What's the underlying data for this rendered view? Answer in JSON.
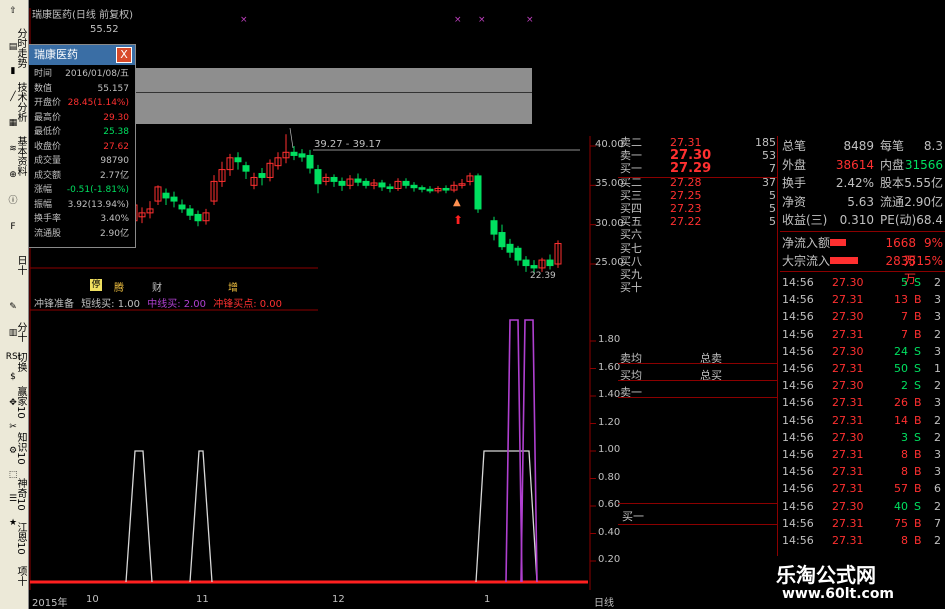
{
  "title": {
    "stock_name": "瑞康医药",
    "period": "(日线 前复权)",
    "hi_marker": "55.52"
  },
  "popup": {
    "header": "瑞康医药",
    "close": "X",
    "rows": [
      {
        "k": "时间",
        "v": "2016/01/08/五",
        "color": "#c0c0c0"
      },
      {
        "k": "数值",
        "v": "55.157",
        "color": "#c0c0c0"
      },
      {
        "k": "开盘价",
        "v": "28.45(1.14%)",
        "color": "#ff3030"
      },
      {
        "k": "最高价",
        "v": "29.30",
        "color": "#ff3030"
      },
      {
        "k": "最低价",
        "v": "25.38",
        "color": "#00e060"
      },
      {
        "k": "收盘价",
        "v": "27.62",
        "color": "#ff3030"
      },
      {
        "k": "成交量",
        "v": "98790",
        "color": "#c0c0c0"
      },
      {
        "k": "成交额",
        "v": "2.77亿",
        "color": "#c0c0c0"
      },
      {
        "k": "涨幅",
        "v": "-0.51(-1.81%)",
        "color": "#00e060"
      },
      {
        "k": "振幅",
        "v": "3.92(13.94%)",
        "color": "#c0c0c0"
      },
      {
        "k": "换手率",
        "v": "3.40%",
        "color": "#c0c0c0"
      },
      {
        "k": "流通股",
        "v": "2.90亿",
        "color": "#c0c0c0"
      }
    ]
  },
  "price_axis": [
    "40.00",
    "35.00",
    "30.00",
    "25.00"
  ],
  "range_label": "39.27 - 39.17",
  "low_label": "22.39",
  "event_tags": [
    "停",
    "腾",
    "财",
    "增"
  ],
  "indicator": {
    "name": "冲锋准备",
    "l1": "短线买: 1.00",
    "l2": "中线买: 2.00",
    "l3": "冲锋买点: 0.00",
    "axis": [
      "1.80",
      "1.60",
      "1.40",
      "1.20",
      "1.00",
      "0.80",
      "0.60",
      "0.40",
      "0.20"
    ]
  },
  "date_axis": [
    "2015年",
    "10",
    "11",
    "12",
    "1",
    "日线"
  ],
  "order_book": [
    {
      "l": "卖二",
      "p": "27.31",
      "q": "185",
      "pc": "#ff3030"
    },
    {
      "l": "卖一",
      "p": "27.30",
      "q": "53",
      "pc": "#ff3030"
    },
    {
      "l": "买一",
      "p": "27.29",
      "q": "7",
      "pc": "#ff3030"
    },
    {
      "l": "买二",
      "p": "27.28",
      "q": "37",
      "pc": "#ff3030"
    },
    {
      "l": "买三",
      "p": "27.25",
      "q": "5",
      "pc": "#ff3030"
    },
    {
      "l": "买四",
      "p": "27.23",
      "q": "5",
      "pc": "#ff3030"
    },
    {
      "l": "买五",
      "p": "27.22",
      "q": "5",
      "pc": "#ff3030"
    },
    {
      "l": "买六",
      "p": "",
      "q": "",
      "pc": "#ff3030"
    },
    {
      "l": "买七",
      "p": "",
      "q": "",
      "pc": "#ff3030"
    },
    {
      "l": "买八",
      "p": "",
      "q": "",
      "pc": "#ff3030"
    },
    {
      "l": "买九",
      "p": "",
      "q": "",
      "pc": "#ff3030"
    },
    {
      "l": "买十",
      "p": "",
      "q": "",
      "pc": "#ff3030"
    }
  ],
  "book_summary": [
    {
      "l": "卖均",
      "r": "总卖"
    },
    {
      "l": "买均",
      "r": "总买"
    },
    {
      "l": "卖一",
      "r": ""
    }
  ],
  "lower_buy_label": "买一",
  "stats": [
    {
      "k1": "总笔",
      "v1": "8489",
      "c1": "#c0c0c0",
      "k2": "每笔",
      "v2": "8.3",
      "c2": "#c0c0c0"
    },
    {
      "k1": "外盘",
      "v1": "38614",
      "c1": "#ff3030",
      "k2": "内盘",
      "v2": "31566",
      "c2": "#00e060"
    },
    {
      "k1": "换手",
      "v1": "2.42%",
      "c1": "#c0c0c0",
      "k2": "股本",
      "v2": "5.55亿",
      "c2": "#c0c0c0"
    },
    {
      "k1": "净资",
      "v1": "5.63",
      "c1": "#c0c0c0",
      "k2": "流通",
      "v2": "2.90亿",
      "c2": "#c0c0c0"
    },
    {
      "k1": "收益(三)",
      "v1": "0.310",
      "c1": "#c0c0c0",
      "k2": "PE(动)",
      "v2": "68.4",
      "c2": "#c0c0c0"
    }
  ],
  "flows": [
    {
      "k": "净流入额",
      "v": "1668万",
      "pct": "9%",
      "fill": 0.4
    },
    {
      "k": "大宗流入",
      "v": "2838万",
      "pct": "15%",
      "fill": 0.7
    }
  ],
  "ticks": [
    {
      "t": "14:56",
      "p": "27.30",
      "v": "5",
      "s": "S",
      "n": "2"
    },
    {
      "t": "14:56",
      "p": "27.31",
      "v": "13",
      "s": "B",
      "n": "3"
    },
    {
      "t": "14:56",
      "p": "27.30",
      "v": "7",
      "s": "B",
      "n": "3"
    },
    {
      "t": "14:56",
      "p": "27.31",
      "v": "7",
      "s": "B",
      "n": "2"
    },
    {
      "t": "14:56",
      "p": "27.30",
      "v": "24",
      "s": "S",
      "n": "3"
    },
    {
      "t": "14:56",
      "p": "27.31",
      "v": "50",
      "s": "S",
      "n": "1"
    },
    {
      "t": "14:56",
      "p": "27.30",
      "v": "2",
      "s": "S",
      "n": "2"
    },
    {
      "t": "14:56",
      "p": "27.31",
      "v": "26",
      "s": "B",
      "n": "3"
    },
    {
      "t": "14:56",
      "p": "27.31",
      "v": "14",
      "s": "B",
      "n": "2"
    },
    {
      "t": "14:56",
      "p": "27.30",
      "v": "3",
      "s": "S",
      "n": "2"
    },
    {
      "t": "14:56",
      "p": "27.31",
      "v": "8",
      "s": "B",
      "n": "3"
    },
    {
      "t": "14:56",
      "p": "27.31",
      "v": "8",
      "s": "B",
      "n": "3"
    },
    {
      "t": "14:56",
      "p": "27.31",
      "v": "57",
      "s": "B",
      "n": "6"
    },
    {
      "t": "14:56",
      "p": "27.30",
      "v": "40",
      "s": "S",
      "n": "2"
    },
    {
      "t": "14:56",
      "p": "27.31",
      "v": "75",
      "s": "B",
      "n": "7"
    },
    {
      "t": "14:56",
      "p": "27.31",
      "v": "8",
      "s": "B",
      "n": "2"
    }
  ],
  "toolbar_vertical": [
    "分时走势",
    "技术分析",
    "基本资料",
    "日十",
    "分十",
    "切换",
    "赢家10",
    "知识10",
    "神奇10",
    "江恩10",
    "项十"
  ],
  "logo": {
    "cn": "乐淘公式网",
    "url": "www.60lt.com"
  },
  "colors": {
    "up": "#ff3030",
    "down": "#00e060",
    "grid": "#8b0000",
    "axis": "#c0c0c0",
    "purple": "#b040d0"
  }
}
